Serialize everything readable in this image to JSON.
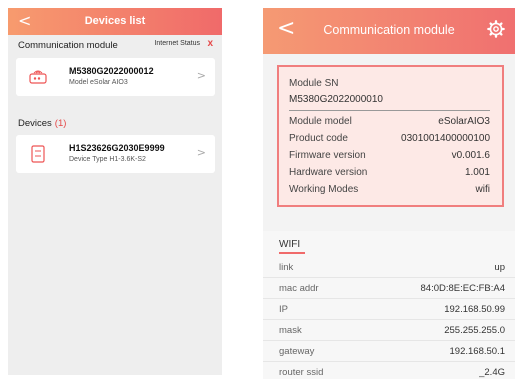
{
  "left": {
    "header": {
      "back_glyph": "<",
      "title": "Devices list"
    },
    "comm_section": {
      "label": "Communication module",
      "internet_status_label": "Internet Status",
      "internet_status_icon": "x"
    },
    "comm_card": {
      "sn": "M5380G2022000012",
      "subtitle": "Model  eSolar AIO3",
      "chevron": ">"
    },
    "devices_section": {
      "label": "Devices",
      "count": "(1)"
    },
    "device_card": {
      "sn": "H1S23626G2030E9999",
      "subtitle": "Device Type  H1-3.6K-S2",
      "chevron": ">"
    }
  },
  "right": {
    "header": {
      "back_glyph": "<",
      "title": "Communication module"
    },
    "module_sn_label": "Module SN",
    "module_sn": "M5380G2022000010",
    "info": [
      {
        "key": "Module model",
        "value": "eSolarAIO3"
      },
      {
        "key": "Product code",
        "value": "0301001400000100"
      },
      {
        "key": "Firmware version",
        "value": "v0.001.6"
      },
      {
        "key": "Hardware version",
        "value": "1.001"
      },
      {
        "key": "Working Modes",
        "value": "wifi"
      }
    ],
    "wifi": {
      "title": "WIFI",
      "rows": [
        {
          "key": "link",
          "value": "up"
        },
        {
          "key": "mac addr",
          "value": "84:0D:8E:EC:FB:A4"
        },
        {
          "key": "IP",
          "value": "192.168.50.99"
        },
        {
          "key": "mask",
          "value": "255.255.255.0"
        },
        {
          "key": "gateway",
          "value": "192.168.50.1"
        },
        {
          "key": "router ssid",
          "value": "_2.4G"
        }
      ]
    }
  },
  "colors": {
    "accent": "#f06a6a",
    "header_start": "#f79b6e",
    "info_box_bg": "#fde9e6",
    "info_box_border": "#f07e7e",
    "status_red": "#e54848"
  },
  "icons": {
    "comm_module": "router-icon",
    "device": "inverter-icon",
    "settings": "gear-icon"
  }
}
